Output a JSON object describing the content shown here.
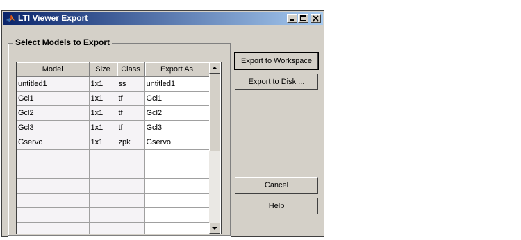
{
  "window": {
    "title": "LTI Viewer Export"
  },
  "titlebar": {
    "buttons": [
      "minimize-icon",
      "maximize-icon",
      "close-icon"
    ]
  },
  "group": {
    "label": "Select Models to Export"
  },
  "table": {
    "columns": [
      "Model",
      "Size",
      "Class",
      "Export As"
    ],
    "rows": [
      [
        "untitled1",
        "1x1",
        "ss",
        "untitled1"
      ],
      [
        "Gcl1",
        "1x1",
        "tf",
        "Gcl1"
      ],
      [
        "Gcl2",
        "1x1",
        "tf",
        "Gcl2"
      ],
      [
        "Gcl3",
        "1x1",
        "tf",
        "Gcl3"
      ],
      [
        "Gservo",
        "1x1",
        "zpk",
        "Gservo"
      ],
      [
        "",
        "",
        "",
        ""
      ],
      [
        "",
        "",
        "",
        ""
      ],
      [
        "",
        "",
        "",
        ""
      ],
      [
        "",
        "",
        "",
        ""
      ],
      [
        "",
        "",
        "",
        ""
      ],
      [
        "",
        "",
        "",
        ""
      ]
    ]
  },
  "buttons": {
    "export_workspace": "Export to Workspace",
    "export_disk": "Export to Disk ...",
    "cancel": "Cancel",
    "help": "Help"
  },
  "colors": {
    "titlebar_start": "#0a246a",
    "titlebar_end": "#a6caf0",
    "window_bg": "#d4d0c8",
    "cell_tint": "#f5f3f6"
  }
}
